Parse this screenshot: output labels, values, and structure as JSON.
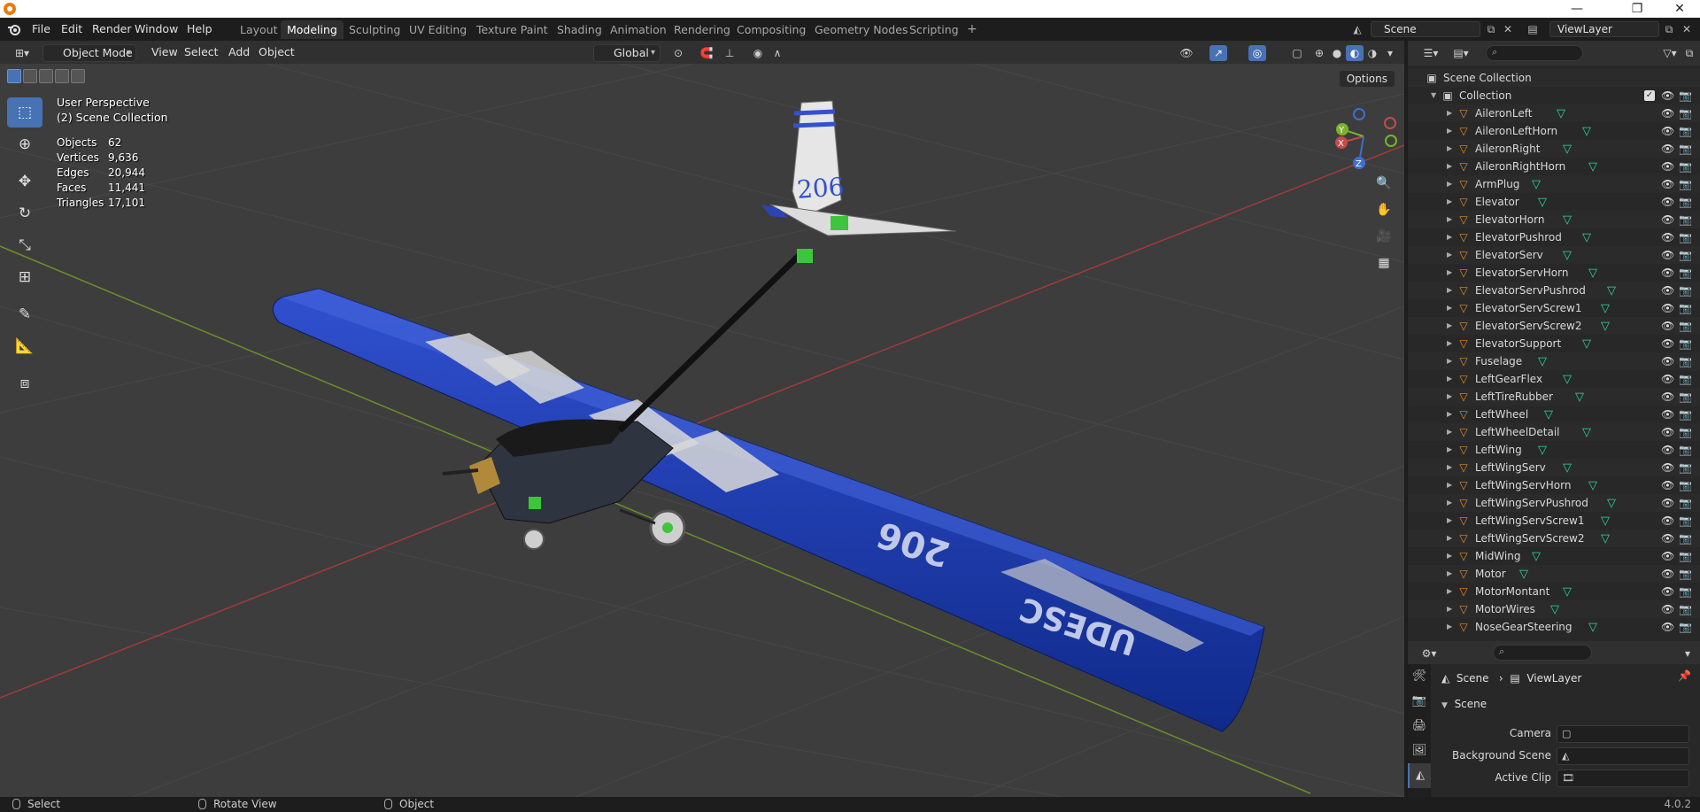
{
  "menu": {
    "file": "File",
    "edit": "Edit",
    "render": "Render",
    "window": "Window",
    "help": "Help"
  },
  "workspaces": [
    "Layout",
    "Modeling",
    "Sculpting",
    "UV Editing",
    "Texture Paint",
    "Shading",
    "Animation",
    "Rendering",
    "Compositing",
    "Geometry Nodes",
    "Scripting"
  ],
  "active_workspace": "Modeling",
  "scene_name": "Scene",
  "view_layer_name": "ViewLayer",
  "viewport": {
    "mode": "Object Mode",
    "menus": {
      "view": "View",
      "select": "Select",
      "add": "Add",
      "object": "Object"
    },
    "orientation": "Global",
    "options": "Options",
    "perspective": "User Perspective",
    "collection": "(2) Scene Collection",
    "stats": [
      {
        "k": "Objects",
        "v": "62"
      },
      {
        "k": "Vertices",
        "v": "9,636"
      },
      {
        "k": "Edges",
        "v": "20,944"
      },
      {
        "k": "Faces",
        "v": "11,441"
      },
      {
        "k": "Triangles",
        "v": "17,101"
      }
    ],
    "tail_number": "206",
    "wing_text": "206",
    "brand_text": "UDESC",
    "gizmo": {
      "x": "X",
      "y": "Y",
      "z": "Z"
    }
  },
  "outliner": {
    "scene_collection": "Scene Collection",
    "collection": "Collection",
    "objects": [
      "AileronLeft",
      "AileronLeftHorn",
      "AileronRight",
      "AileronRightHorn",
      "ArmPlug",
      "Elevator",
      "ElevatorHorn",
      "ElevatorPushrod",
      "ElevatorServ",
      "ElevatorServHorn",
      "ElevatorServPushrod",
      "ElevatorServScrew1",
      "ElevatorServScrew2",
      "ElevatorSupport",
      "Fuselage",
      "LeftGearFlex",
      "LeftTireRubber",
      "LeftWheel",
      "LeftWheelDetail",
      "LeftWing",
      "LeftWingServ",
      "LeftWingServHorn",
      "LeftWingServPushrod",
      "LeftWingServScrew1",
      "LeftWingServScrew2",
      "MidWing",
      "Motor",
      "MotorMontant",
      "MotorWires",
      "NoseGearSteering"
    ]
  },
  "properties": {
    "breadcrumb_scene": "Scene",
    "breadcrumb_layer": "ViewLayer",
    "panel": "Scene",
    "camera_label": "Camera",
    "background_scene_label": "Background Scene",
    "active_clip_label": "Active Clip"
  },
  "statusbar": {
    "select": "Select",
    "rotate": "Rotate View",
    "object": "Object",
    "version": "4.0.2"
  },
  "colors": {
    "accent": "#4772b3",
    "wing_blue": "#1e3fb5",
    "object_orange": "#e8892a",
    "mesh_green": "#2bd9a2"
  }
}
